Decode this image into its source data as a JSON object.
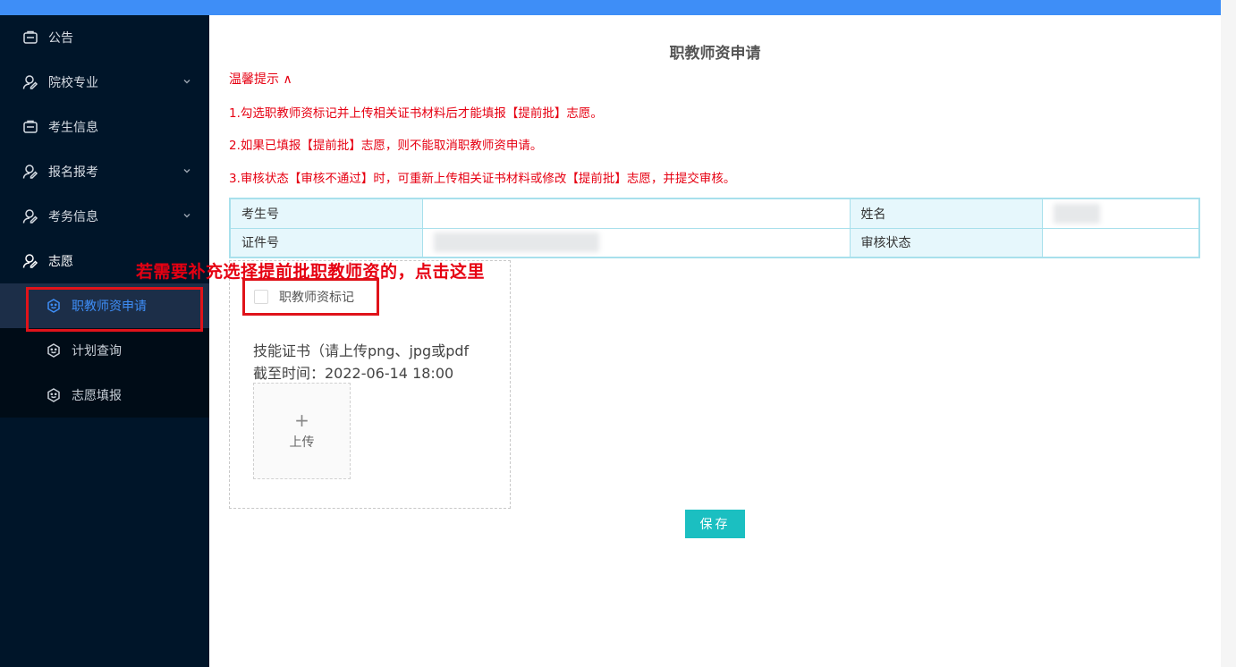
{
  "sidebar": {
    "items": [
      {
        "label": "公告",
        "icon": "notice-icon",
        "expandable": false
      },
      {
        "label": "院校专业",
        "icon": "user-icon",
        "expandable": true
      },
      {
        "label": "考生信息",
        "icon": "notice-icon",
        "expandable": false
      },
      {
        "label": "报名报考",
        "icon": "user-icon",
        "expandable": true
      },
      {
        "label": "考务信息",
        "icon": "user-icon",
        "expandable": true
      },
      {
        "label": "志愿",
        "icon": "user-icon",
        "expandable": true
      }
    ],
    "submenu": [
      {
        "label": "职教师资申请",
        "icon": "smile-icon",
        "active": true
      },
      {
        "label": "计划查询",
        "icon": "smile-icon",
        "active": false
      },
      {
        "label": "志愿填报",
        "icon": "smile-icon",
        "active": false
      }
    ]
  },
  "annotation": {
    "callout": "若需要补充选择提前批职教师资的，点击这里"
  },
  "main": {
    "title": "职教师资申请",
    "tips_toggle": "温馨提示 ∧",
    "tips": [
      "1.勾选职教师资标记并上传相关证书材料后才能填报【提前批】志愿。",
      "2.如果已填报【提前批】志愿，则不能取消职教师资申请。",
      "3.审核状态【审核不通过】时，可重新上传相关证书材料或修改【提前批】志愿，并提交审核。"
    ],
    "table": {
      "exam_no_label": "考生号",
      "name_label": "姓名",
      "id_label": "证件号",
      "status_label": "审核状态"
    },
    "checkbox_label": "职教师资标记",
    "cert_line1": "技能证书（请上传png、jpg或pdf",
    "cert_line2": "截至时间：2022-06-14 18:00",
    "upload_label": "上传",
    "upload_plus": "+",
    "save_label": "保存"
  },
  "colors": {
    "topbar": "#3e8ef7",
    "sidebar": "#001529",
    "accent": "#3e8ef7",
    "warning_text": "#e60012",
    "save_button": "#1bbfc1"
  }
}
